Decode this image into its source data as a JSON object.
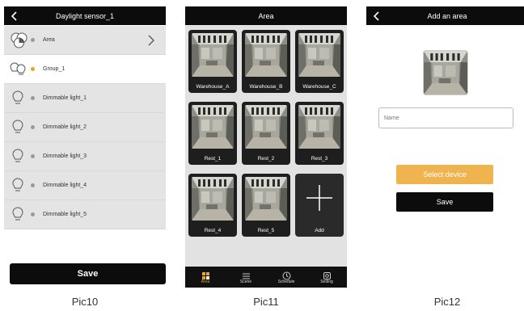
{
  "pic10": {
    "title": "Daylight sensor_1",
    "rows": [
      {
        "label": "Area",
        "icon": "area-icon",
        "dot_color": "#9a9a9a",
        "has_chevron": true
      },
      {
        "label": "Group_1",
        "icon": "group-icon",
        "dot_color": "#f0a21c",
        "has_chevron": false
      },
      {
        "label": "Dimmable light_1",
        "icon": "bulb-icon",
        "dot_color": "#9a9a9a",
        "has_chevron": false
      },
      {
        "label": "Dimmable light_2",
        "icon": "bulb-icon",
        "dot_color": "#9a9a9a",
        "has_chevron": false
      },
      {
        "label": "Dimmable light_3",
        "icon": "bulb-icon",
        "dot_color": "#9a9a9a",
        "has_chevron": false
      },
      {
        "label": "Dimmable light_4",
        "icon": "bulb-icon",
        "dot_color": "#9a9a9a",
        "has_chevron": false
      },
      {
        "label": "Dimmable light_5",
        "icon": "bulb-icon",
        "dot_color": "#9a9a9a",
        "has_chevron": false
      }
    ],
    "save_label": "Save",
    "caption": "Pic10"
  },
  "pic11": {
    "title": "Area",
    "tiles": [
      "Warehouse_A",
      "Warehouse_B",
      "Warehouse_C",
      "Rest_1",
      "Rest_2",
      "Rest_3",
      "Rest_4",
      "Rest_5"
    ],
    "add_label": "Add",
    "tabs": [
      {
        "label": "Area",
        "icon": "area-icon",
        "active": true
      },
      {
        "label": "Scene",
        "icon": "scene-icon",
        "active": false
      },
      {
        "label": "Schedule",
        "icon": "clock-icon",
        "active": false
      },
      {
        "label": "Setting",
        "icon": "gear-icon",
        "active": false
      }
    ],
    "caption": "Pic11"
  },
  "pic12": {
    "title": "Add an area",
    "name_placeholder": "Name",
    "select_label": "Select device",
    "save_label": "Save",
    "caption": "Pic12"
  },
  "colors": {
    "accent_orange": "#efb450",
    "bar_black": "#0c0c0c",
    "row_grey": "#e4e4e4",
    "tab_active": "#e6a534"
  }
}
